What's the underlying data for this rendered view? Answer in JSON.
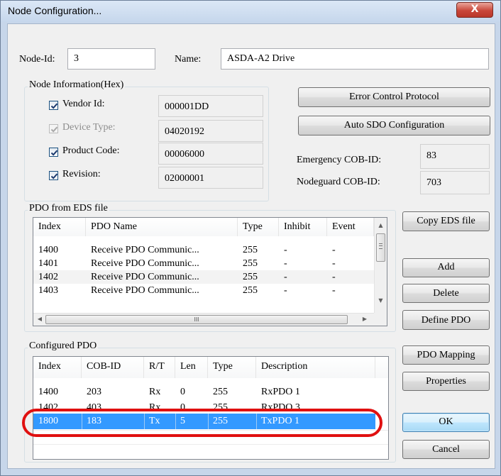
{
  "window": {
    "title": "Node Configuration...",
    "close_label": "X"
  },
  "node": {
    "id_label": "Node-Id:",
    "id_value": "3",
    "name_label": "Name:",
    "name_value": "ASDA-A2 Drive"
  },
  "node_info": {
    "title": "Node Information(Hex)",
    "items": [
      {
        "label": "Vendor Id:",
        "value": "000001DD",
        "checked": true,
        "enabled": true
      },
      {
        "label": "Device Type:",
        "value": "04020192",
        "checked": true,
        "enabled": false
      },
      {
        "label": "Product Code:",
        "value": "00006000",
        "checked": true,
        "enabled": true
      },
      {
        "label": "Revision:",
        "value": "02000001",
        "checked": true,
        "enabled": true
      }
    ]
  },
  "right_panel": {
    "error_control_button": "Error Control Protocol",
    "auto_sdo_button": "Auto SDO Configuration",
    "emergency_label": "Emergency COB-ID:",
    "emergency_value": "83",
    "nodeguard_label": "Nodeguard COB-ID:",
    "nodeguard_value": "703"
  },
  "pdo_eds": {
    "title": "PDO from EDS file",
    "columns": [
      "Index",
      "PDO Name",
      "Type",
      "Inhibit",
      "Event"
    ],
    "rows": [
      [
        "1400",
        "Receive PDO Communic...",
        "255",
        "-",
        "-"
      ],
      [
        "1401",
        "Receive PDO Communic...",
        "255",
        "-",
        "-"
      ],
      [
        "1402",
        "Receive PDO Communic...",
        "255",
        "-",
        "-"
      ],
      [
        "1403",
        "Receive PDO Communic...",
        "255",
        "-",
        "-"
      ]
    ],
    "hscroll_grip": "III"
  },
  "eds_buttons": {
    "copy": "Copy EDS file",
    "add": "Add",
    "delete": "Delete",
    "define": "Define PDO"
  },
  "configured_pdo": {
    "title": "Configured PDO",
    "columns": [
      "Index",
      "COB-ID",
      "R/T",
      "Len",
      "Type",
      "Description"
    ],
    "rows": [
      [
        "1400",
        "203",
        "Rx",
        "0",
        "255",
        "RxPDO 1"
      ],
      [
        "1402",
        "403",
        "Rx",
        "0",
        "255",
        "RxPDO 3"
      ],
      [
        "1800",
        "183",
        "Tx",
        "5",
        "255",
        "TxPDO 1"
      ]
    ],
    "selected_row": 2
  },
  "cfg_buttons": {
    "mapping": "PDO Mapping",
    "properties": "Properties",
    "ok": "OK",
    "cancel": "Cancel"
  },
  "colors": {
    "selection": "#3399ff",
    "annotation": "#e01010",
    "title_bar": "#c6d7ec"
  }
}
